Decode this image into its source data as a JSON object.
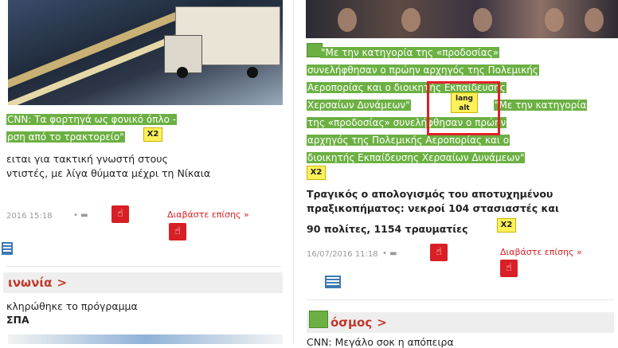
{
  "left": {
    "headline_highlight_line1": "CNN: Τα φορτηγά ως φονικό όπλο -",
    "headline_highlight_line2": "ρση από το τρακτορείο\"",
    "x2_label": "X2",
    "summary_line1": "ειται για τακτική γνωστή στους",
    "summary_line2": "ντιστές, με λίγα θύματα μέχρι τη Νίκαια",
    "timestamp": "2016 15:18",
    "readmore": "Διαβάστε επίσης",
    "readmore_arrow": "»",
    "section_title": "ινωνία",
    "section_chevron": ">",
    "next_line1": "κληρώθηκε το πρόγραμμα",
    "next_line2": "ΣΠΑ"
  },
  "right": {
    "quote_line1": "\"Με την κατηγορία της «προδοσίας»",
    "quote_line2": "συνελήφθησαν ο πρώην αρχηγός της Πολεμικής",
    "quote_line3": "Αεροπορίας και ο διοικητής Εκπαίδευσης",
    "quote_line4a": "Χερσαίων Δυνάμεων\"",
    "quote_line4b": "\"Με την κατηγορία",
    "quote_line5": "της «προδοσίας» συνελήφθησαν ο πρώην",
    "quote_line6": "αρχηγός της Πολεμικής Αεροπορίας και ο",
    "quote_line7": "διοικητής Εκπαίδευσης Χερσαίων Δυνάμεων\"",
    "lang_badge_line1": "lang",
    "lang_badge_line2": "alt",
    "x2_label": "X2",
    "body_line1": "Τραγικός ο απολογισμός του αποτυχημένου",
    "body_line2": "πραξικοπήματος: νεκροί 104 στασιαστές και",
    "body_line3": "90 πολίτες, 1154 τραυματίες",
    "timestamp": "16/07/2016 11:18",
    "readmore": "Διαβάστε επίσης",
    "readmore_arrow": "»",
    "section_title": "όσμος",
    "section_chevron": ">",
    "next_line1": "CNN: Μεγάλο σοκ η απόπειρα"
  },
  "colors": {
    "highlight_green": "#6cb043",
    "accent_red": "#d81f26",
    "badge_yellow": "#fff15a",
    "section_bg": "#eeeeee"
  },
  "icons": [
    "hand-pointer-icon",
    "comment-icon",
    "list-icon",
    "x2-badge-icon",
    "lang-alt-badge-icon"
  ]
}
